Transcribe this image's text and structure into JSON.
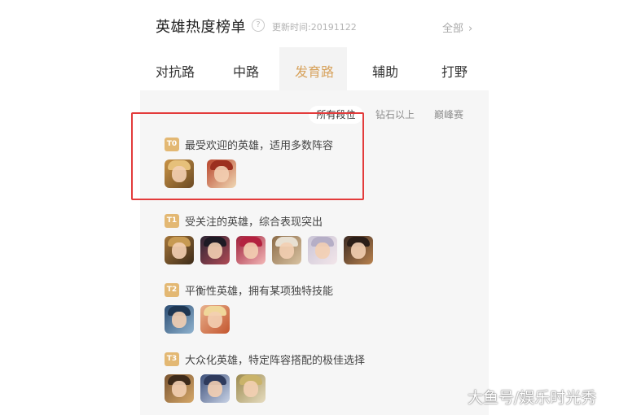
{
  "header": {
    "title": "英雄热度榜单",
    "help_icon": "question-circle-icon",
    "update_time": "更新时间:20191122",
    "all_label": "全部"
  },
  "tabs": [
    {
      "label": "对抗路",
      "active": false
    },
    {
      "label": "中路",
      "active": false
    },
    {
      "label": "发育路",
      "active": true
    },
    {
      "label": "辅助",
      "active": false
    },
    {
      "label": "打野",
      "active": false
    }
  ],
  "filters": [
    {
      "label": "所有段位",
      "active": true
    },
    {
      "label": "钻石以上",
      "active": false
    },
    {
      "label": "巅峰赛",
      "active": false
    }
  ],
  "tiers": [
    {
      "badge": "T0",
      "desc": "最受欢迎的英雄，适用多数阵容",
      "hero_count": 2
    },
    {
      "badge": "T1",
      "desc": "受关注的英雄，综合表现突出",
      "hero_count": 6
    },
    {
      "badge": "T2",
      "desc": "平衡性英雄，拥有某项独特技能",
      "hero_count": 2
    },
    {
      "badge": "T3",
      "desc": "大众化英雄，特定阵容搭配的极佳选择",
      "hero_count": 3
    }
  ],
  "watermark": "大鱼号/娱乐时光秀",
  "colors": {
    "accent": "#d7a25c",
    "badge": "#e3b873",
    "highlight_border": "#e33b3b"
  }
}
